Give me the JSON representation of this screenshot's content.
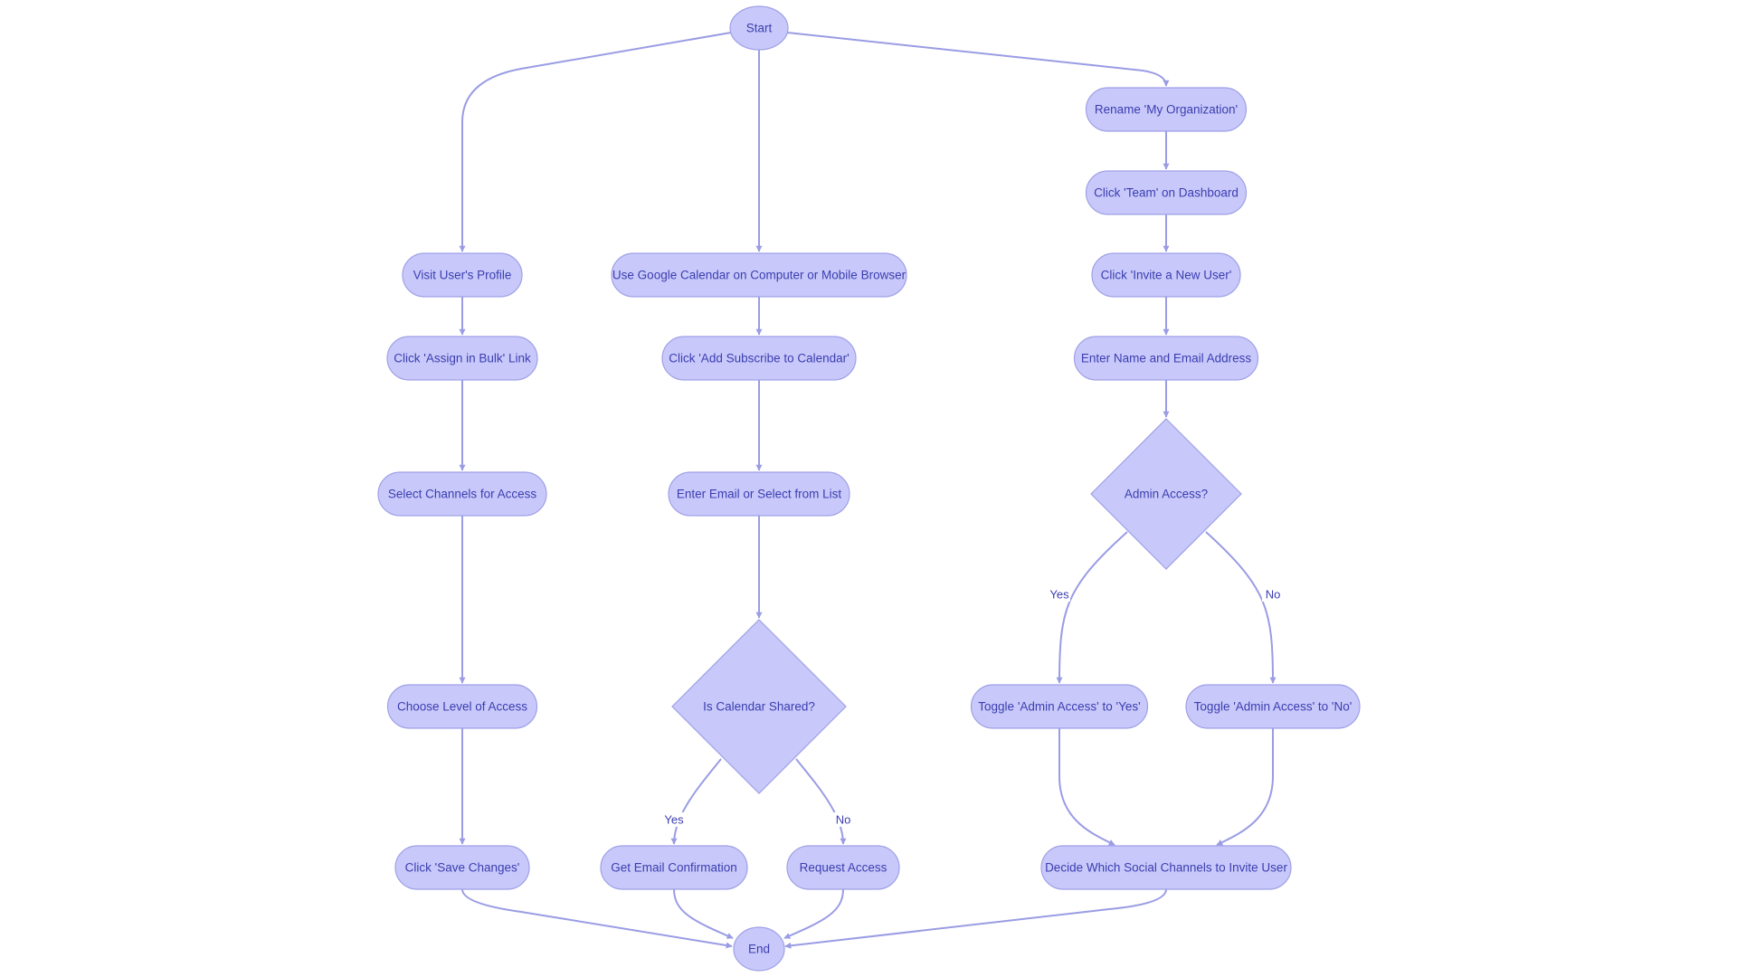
{
  "diagram": {
    "type": "flowchart",
    "colors": {
      "node_fill": "#c8c9fa",
      "node_stroke": "#9fa0e6",
      "text": "#3b3db0",
      "edge": "#9a9ce4",
      "background": "#ffffff"
    },
    "nodes": [
      {
        "id": "start",
        "label": "Start",
        "shape": "circle"
      },
      {
        "id": "visit_profile",
        "label": "Visit User's Profile",
        "shape": "stadium"
      },
      {
        "id": "assign_bulk",
        "label": "Click 'Assign in Bulk' Link",
        "shape": "stadium"
      },
      {
        "id": "select_channels",
        "label": "Select Channels for Access",
        "shape": "stadium"
      },
      {
        "id": "choose_level",
        "label": "Choose Level of Access",
        "shape": "stadium"
      },
      {
        "id": "save_changes",
        "label": "Click 'Save Changes'",
        "shape": "stadium"
      },
      {
        "id": "use_gcal",
        "label": "Use Google Calendar on Computer or Mobile Browser",
        "shape": "stadium"
      },
      {
        "id": "add_subscribe",
        "label": "Click 'Add Subscribe to Calendar'",
        "shape": "stadium"
      },
      {
        "id": "enter_email_list",
        "label": "Enter Email or Select from List",
        "shape": "stadium"
      },
      {
        "id": "is_shared",
        "label": "Is Calendar Shared?",
        "shape": "diamond"
      },
      {
        "id": "email_confirm",
        "label": "Get Email Confirmation",
        "shape": "stadium"
      },
      {
        "id": "request_access",
        "label": "Request Access",
        "shape": "stadium"
      },
      {
        "id": "rename_org",
        "label": "Rename 'My Organization'",
        "shape": "stadium"
      },
      {
        "id": "click_team",
        "label": "Click 'Team' on Dashboard",
        "shape": "stadium"
      },
      {
        "id": "invite_user",
        "label": "Click 'Invite a New User'",
        "shape": "stadium"
      },
      {
        "id": "enter_name_email",
        "label": "Enter Name and Email Address",
        "shape": "stadium"
      },
      {
        "id": "admin_access",
        "label": "Admin Access?",
        "shape": "diamond"
      },
      {
        "id": "toggle_yes",
        "label": "Toggle 'Admin Access' to 'Yes'",
        "shape": "stadium"
      },
      {
        "id": "toggle_no",
        "label": "Toggle 'Admin Access' to 'No'",
        "shape": "stadium"
      },
      {
        "id": "decide_social",
        "label": "Decide Which Social Channels to Invite User",
        "shape": "stadium"
      },
      {
        "id": "end",
        "label": "End",
        "shape": "circle"
      }
    ],
    "edges": [
      {
        "from": "start",
        "to": "visit_profile",
        "label": ""
      },
      {
        "from": "start",
        "to": "use_gcal",
        "label": ""
      },
      {
        "from": "start",
        "to": "rename_org",
        "label": ""
      },
      {
        "from": "visit_profile",
        "to": "assign_bulk",
        "label": ""
      },
      {
        "from": "assign_bulk",
        "to": "select_channels",
        "label": ""
      },
      {
        "from": "select_channels",
        "to": "choose_level",
        "label": ""
      },
      {
        "from": "choose_level",
        "to": "save_changes",
        "label": ""
      },
      {
        "from": "use_gcal",
        "to": "add_subscribe",
        "label": ""
      },
      {
        "from": "add_subscribe",
        "to": "enter_email_list",
        "label": ""
      },
      {
        "from": "enter_email_list",
        "to": "is_shared",
        "label": ""
      },
      {
        "from": "is_shared",
        "to": "email_confirm",
        "label": "Yes"
      },
      {
        "from": "is_shared",
        "to": "request_access",
        "label": "No"
      },
      {
        "from": "rename_org",
        "to": "click_team",
        "label": ""
      },
      {
        "from": "click_team",
        "to": "invite_user",
        "label": ""
      },
      {
        "from": "invite_user",
        "to": "enter_name_email",
        "label": ""
      },
      {
        "from": "enter_name_email",
        "to": "admin_access",
        "label": ""
      },
      {
        "from": "admin_access",
        "to": "toggle_yes",
        "label": "Yes"
      },
      {
        "from": "admin_access",
        "to": "toggle_no",
        "label": "No"
      },
      {
        "from": "toggle_yes",
        "to": "decide_social",
        "label": ""
      },
      {
        "from": "toggle_no",
        "to": "decide_social",
        "label": ""
      },
      {
        "from": "save_changes",
        "to": "end",
        "label": ""
      },
      {
        "from": "email_confirm",
        "to": "end",
        "label": ""
      },
      {
        "from": "request_access",
        "to": "end",
        "label": ""
      },
      {
        "from": "decide_social",
        "to": "end",
        "label": ""
      }
    ]
  }
}
